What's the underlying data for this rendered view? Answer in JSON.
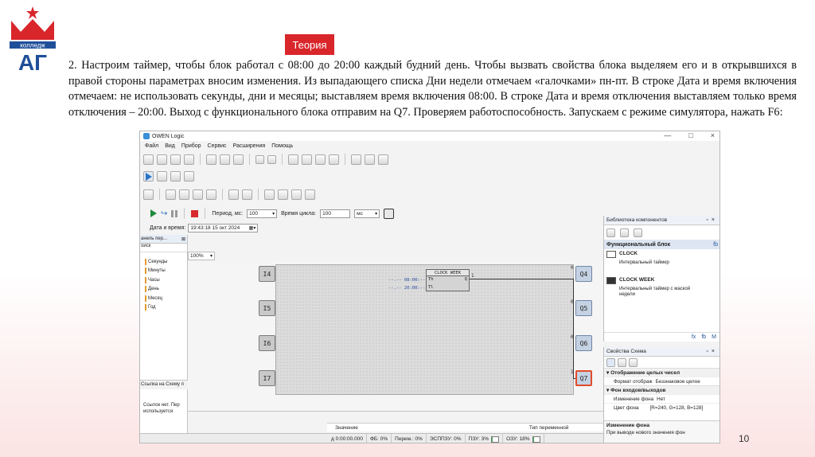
{
  "slide": {
    "logo_text": "колледж",
    "logo_letters": "АГ",
    "badge": "Теория",
    "paragraph": "2. Настроим таймер, чтобы блок работал с 08:00 до 20:00 каждый будний день. Чтобы вызвать свойства блока выделяем его и в открывшихся в правой стороны параметрах вносим изменения. Из выпадающего списка Дни недели отмечаем «галочками» пн-пт.  В строке Дата и время включения отмечаем: не использовать секунды, дни и месяцы; выставляем время включения 08:00. В строке Дата и время отключения выставляем только время отключения – 20:00. Выход с функционального блока отправим на Q7. Проверяем работоспособность. Запускаем с режиме симулятора, нажать F6:",
    "page_number": "10",
    "brand_red": "#d9262b"
  },
  "window": {
    "title": "OWEN Logic",
    "controls": [
      "—",
      "□",
      "×"
    ]
  },
  "menu": [
    "Файл",
    "Вид",
    "Прибор",
    "Сервис",
    "Расширения",
    "Помощь"
  ],
  "sim_toolbar": {
    "period_label": "Период, мс:",
    "period_value": "100",
    "cycle_label": "Время цикла:",
    "cycle_value": "100",
    "cycle_unit": "мс"
  },
  "datetime_bar": {
    "label": "Дата и время:",
    "value": "19:43:18  15  окт  2024"
  },
  "left_panel": {
    "header": "анель пер...",
    "search": "оиск",
    "items": [
      "Секунды",
      "Минуты",
      "Часы",
      "День",
      "Месяц",
      "Год"
    ],
    "link": "Ссылка на Схему п",
    "note_line1": "Ссылок нет. Пер",
    "note_line2": "используется"
  },
  "canvas": {
    "zoom": "100%",
    "inputs": [
      "I4",
      "I5",
      "I6",
      "I7"
    ],
    "outputs": [
      "Q4",
      "Q5",
      "Q6",
      "Q7"
    ],
    "output_values": [
      "0",
      "0",
      "0",
      "1"
    ],
    "block": {
      "title": "CLOCK WEEK",
      "pin_th": "Th",
      "pin_tl": "Tl",
      "pin_q": "Q",
      "q_value": "1",
      "th_value": "--.-- 08:00:--",
      "tl_value": "--.-- 20:00:--"
    }
  },
  "var_table": {
    "col_value": "Значение",
    "col_type": "Тип переменной"
  },
  "status": {
    "time": "д 0:00:00.000",
    "fb": "ФБ: 0%",
    "vars": "Перем.: 0%",
    "eeprom": "ЭСППЗУ: 0%",
    "flash": "ПЗУ: 3%",
    "ram": "ОЗУ: 18%",
    "ram_fill": 0.18,
    "flash_fill": 0.03
  },
  "library": {
    "title": "Библиотека компонентов",
    "category": "Функциональный блок",
    "category_tag": "fb",
    "items": [
      {
        "name": "CLOCK",
        "desc": "Интервальный таймер"
      },
      {
        "name": "CLOCK WEEK",
        "desc": "Интервальный таймер с маской недели"
      }
    ],
    "footer": [
      "fx",
      "fb",
      "M"
    ]
  },
  "props": {
    "title": "Свойства Схема",
    "sec1": "Отображение целых чисел",
    "row1_label": "Формат отображ",
    "row1_value": "Беззнаковое целое",
    "sec2": "Фон входов/выходов",
    "row2_label": "Изменение фона",
    "row2_value": "Нет",
    "row3_label": "Цвет фона",
    "row3_value": "[R=240, G=128, B=128]",
    "desc_title": "Изменение фона",
    "desc_text": "При выводе нового значения фон"
  }
}
